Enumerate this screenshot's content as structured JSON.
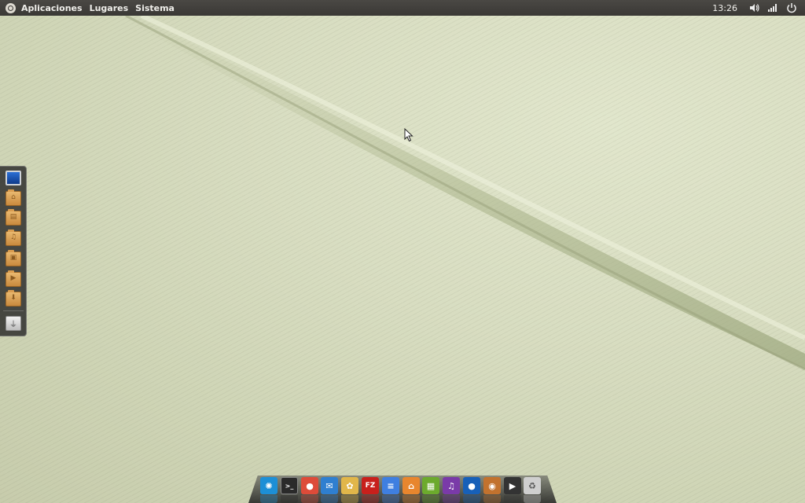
{
  "top_panel": {
    "logo_icon": "ubuntu-logo-icon",
    "menu": [
      "Aplicaciones",
      "Lugares",
      "Sistema"
    ],
    "clock": "13:26",
    "tray_icons": [
      "volume-icon",
      "network-signal-icon",
      "power-icon"
    ]
  },
  "left_dock": {
    "items": [
      {
        "name": "computer-icon",
        "kind": "monitor",
        "glyph": ""
      },
      {
        "name": "home-folder-icon",
        "kind": "folder",
        "glyph": "⌂"
      },
      {
        "name": "documents-folder-icon",
        "kind": "folder",
        "glyph": "▤"
      },
      {
        "name": "music-folder-icon",
        "kind": "folder",
        "glyph": "♫"
      },
      {
        "name": "pictures-folder-icon",
        "kind": "folder",
        "glyph": "▣"
      },
      {
        "name": "videos-folder-icon",
        "kind": "folder",
        "glyph": "▶"
      },
      {
        "name": "downloads-folder-icon",
        "kind": "folder",
        "glyph": "⬇"
      },
      {
        "name": "usb-drive-icon",
        "kind": "usb",
        "glyph": "⏚"
      }
    ]
  },
  "bottom_dock": {
    "items": [
      {
        "name": "ubuntu-menu-icon",
        "color": "#1d8fd6",
        "glyph": "✺"
      },
      {
        "name": "terminal-icon",
        "color": "#2a2a2a",
        "glyph": ">_"
      },
      {
        "name": "chrome-icon",
        "color": "#dd4b39",
        "glyph": "●"
      },
      {
        "name": "mail-icon",
        "color": "#2f7fd0",
        "glyph": "✉"
      },
      {
        "name": "photos-icon",
        "color": "#e1b64a",
        "glyph": "✿"
      },
      {
        "name": "filezilla-icon",
        "color": "#c8201c",
        "glyph": "FZ"
      },
      {
        "name": "text-document-icon",
        "color": "#3f7fe0",
        "glyph": "≡"
      },
      {
        "name": "home-icon",
        "color": "#e8862e",
        "glyph": "⌂"
      },
      {
        "name": "spreadsheet-icon",
        "color": "#6caa2d",
        "glyph": "▦"
      },
      {
        "name": "headphones-icon",
        "color": "#7a3aa8",
        "glyph": "♫"
      },
      {
        "name": "media-player-icon",
        "color": "#1760b8",
        "glyph": "●"
      },
      {
        "name": "speaker-icon",
        "color": "#c2722e",
        "glyph": "◉"
      },
      {
        "name": "video-clapper-icon",
        "color": "#333333",
        "glyph": "▶"
      },
      {
        "name": "trash-icon",
        "color": "#cfcfcf",
        "glyph": "♻"
      }
    ]
  }
}
